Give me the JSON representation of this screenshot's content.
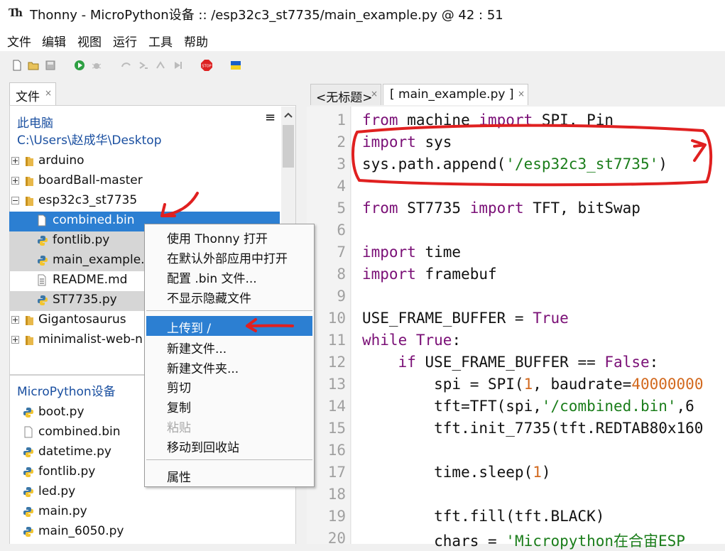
{
  "window": {
    "app_icon": "thonny-logo-icon",
    "title": "Thonny  -  MicroPython设备 :: /esp32c3_st7735/main_example.py  @  42 : 51"
  },
  "menu": [
    "文件",
    "编辑",
    "视图",
    "运行",
    "工具",
    "帮助"
  ],
  "toolbar_icons": [
    "new-file-icon",
    "open-file-icon",
    "save-icon",
    "run-icon",
    "debug-icon",
    "step-over-icon",
    "step-into-icon",
    "step-out-icon",
    "resume-icon",
    "stop-icon",
    "flag-icon"
  ],
  "files_pane": {
    "tab_label": "文件",
    "tab_close": "×",
    "location_title": "此电脑",
    "path": "C:\\Users\\赵成华\\Desktop",
    "menu_glyph": "≡",
    "tree": [
      {
        "name": "arduino",
        "type": "folder",
        "state": "collapsed"
      },
      {
        "name": "boardBall-master",
        "type": "folder",
        "state": "collapsed"
      },
      {
        "name": "esp32c3_st7735",
        "type": "folder",
        "state": "expanded"
      },
      {
        "name": "combined.bin",
        "type": "file",
        "state": "selected"
      },
      {
        "name": "fontlib.py",
        "type": "python",
        "state": "gray"
      },
      {
        "name": "main_example.",
        "type": "python",
        "state": "gray"
      },
      {
        "name": "README.md",
        "type": "file",
        "state": "normal"
      },
      {
        "name": "ST7735.py",
        "type": "python",
        "state": "gray"
      },
      {
        "name": "Gigantosaurus",
        "type": "folder",
        "state": "collapsed"
      },
      {
        "name": "minimalist-web-n",
        "type": "folder",
        "state": "collapsed"
      }
    ]
  },
  "device_pane": {
    "title": "MicroPython设备",
    "files": [
      {
        "name": "boot.py",
        "type": "python"
      },
      {
        "name": "combined.bin",
        "type": "file"
      },
      {
        "name": "datetime.py",
        "type": "python"
      },
      {
        "name": "fontlib.py",
        "type": "python"
      },
      {
        "name": "led.py",
        "type": "python"
      },
      {
        "name": "main.py",
        "type": "python"
      },
      {
        "name": "main_6050.py",
        "type": "python"
      }
    ]
  },
  "context_menu": {
    "items": [
      {
        "label": "使用 Thonny 打开",
        "enabled": true
      },
      {
        "label": "在默认外部应用中打开",
        "enabled": true
      },
      {
        "label": "配置 .bin 文件...",
        "enabled": true
      },
      {
        "label": "不显示隐藏文件",
        "enabled": true
      },
      {
        "label": "上传到 /",
        "enabled": true,
        "highlighted": true
      },
      {
        "label": "新建文件...",
        "enabled": true
      },
      {
        "label": "新建文件夹...",
        "enabled": true
      },
      {
        "label": "剪切",
        "enabled": true
      },
      {
        "label": "复制",
        "enabled": true
      },
      {
        "label": "粘贴",
        "enabled": false
      },
      {
        "label": "移动到回收站",
        "enabled": true
      },
      {
        "label": "属性",
        "enabled": true
      }
    ]
  },
  "editor": {
    "tabs": [
      {
        "label": "<无标题>",
        "close": "×",
        "active": false
      },
      {
        "label": "[ main_example.py ]",
        "close": "×",
        "active": true
      }
    ],
    "line_numbers": [
      "1",
      "2",
      "3",
      "4",
      "5",
      "6",
      "7",
      "8",
      "9",
      "10",
      "11",
      "12",
      "13",
      "14",
      "15",
      "16",
      "17",
      "18",
      "19",
      "20"
    ],
    "code": {
      "l1": {
        "a": "from",
        "b": " machine ",
        "c": "import",
        "d": " SPI, Pin"
      },
      "l2": {
        "a": "import",
        "b": " sys"
      },
      "l3": {
        "a": "sys.path.append(",
        "b": "'/esp32c3_st7735'",
        "c": ")"
      },
      "l5": {
        "a": "from",
        "b": " ST7735 ",
        "c": "import",
        "d": " TFT, bitSwap"
      },
      "l7": {
        "a": "import",
        "b": " time"
      },
      "l8": {
        "a": "import",
        "b": " framebuf"
      },
      "l10": {
        "a": "USE_FRAME_BUFFER = ",
        "b": "True"
      },
      "l11": {
        "a": "while",
        "b": " ",
        "c": "True",
        ":": ":"
      },
      "l12": {
        "a": "    ",
        "b": "if",
        "c": " USE_FRAME_BUFFER == ",
        "d": "False",
        "e": ":"
      },
      "l13": {
        "a": "        spi = SPI(",
        "b": "1",
        ",": ", baudrate=",
        "d": "40000000"
      },
      "l14": {
        "a": "        tft=TFT(spi,",
        "b": "'/combined.bin'",
        ",": ",6"
      },
      "l15": {
        "a": "        tft.init_7735(tft.REDTAB80x160"
      },
      "l17": {
        "a": "        time.sleep(",
        "b": "1",
        ")": ")"
      },
      "l19": {
        "a": "        tft.fill(tft.BLACK)"
      },
      "l20": {
        "a": "        chars = ",
        "b": "'Micropython在合宙ESP"
      }
    }
  },
  "colors": {
    "selection": "#2c7fd2",
    "keyword": "#7a0f76",
    "string": "#1a7d1a",
    "number": "#d2691e",
    "annotation": "#e02020"
  }
}
